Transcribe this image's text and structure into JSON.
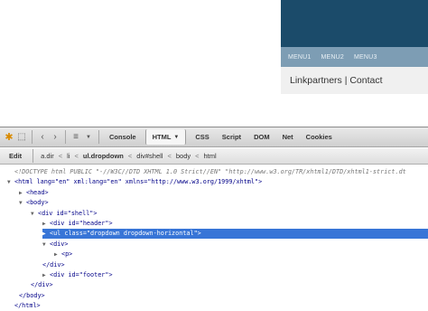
{
  "site": {
    "menu": [
      "MENU1",
      "MENU2",
      "MENU3"
    ],
    "subnav_text": "Linkpartners | Contact"
  },
  "firebug": {
    "tabs": [
      "Console",
      "HTML",
      "CSS",
      "Script",
      "DOM",
      "Net",
      "Cookies"
    ],
    "active_tab": "HTML",
    "edit_label": "Edit",
    "breadcrumbs": [
      "a.dir",
      "li",
      "ul.dropdown",
      "div#shell",
      "body",
      "html"
    ],
    "breadcrumb_sep": "<",
    "tree": [
      {
        "indent": 0,
        "text": "<!DOCTYPE html PUBLIC \"-//W3C//DTD XHTML 1.0 Strict//EN\" \"http://www.w3.org/TR/xhtml1/DTD/xhtml1-strict.dt"
      },
      {
        "indent": 0,
        "twisty": "▼",
        "text": "<html lang=\"en\" xml:lang=\"en\" xmlns=\"http://www.w3.org/1999/xhtml\">"
      },
      {
        "indent": 1,
        "twisty": "▶",
        "text": "<head>"
      },
      {
        "indent": 1,
        "twisty": "▼",
        "text": "<body>"
      },
      {
        "indent": 2,
        "twisty": "▼",
        "text": "<div id=\"shell\">"
      },
      {
        "indent": 3,
        "twisty": "▶",
        "text": "<div id=\"header\">"
      },
      {
        "indent": 3,
        "twisty": "▶",
        "text": "<ul class=\"dropdown dropdown-horizontal\">",
        "selected": true
      },
      {
        "indent": 3,
        "twisty": "▼",
        "text": "<div>"
      },
      {
        "indent": 4,
        "twisty": "▶",
        "text": "<p>"
      },
      {
        "indent": 3,
        "text": "</div>"
      },
      {
        "indent": 3,
        "twisty": "▶",
        "text": "<div id=\"footer\">"
      },
      {
        "indent": 2,
        "text": "</div>"
      },
      {
        "indent": 1,
        "text": "</body>"
      },
      {
        "indent": 0,
        "text": "</html>"
      }
    ]
  }
}
